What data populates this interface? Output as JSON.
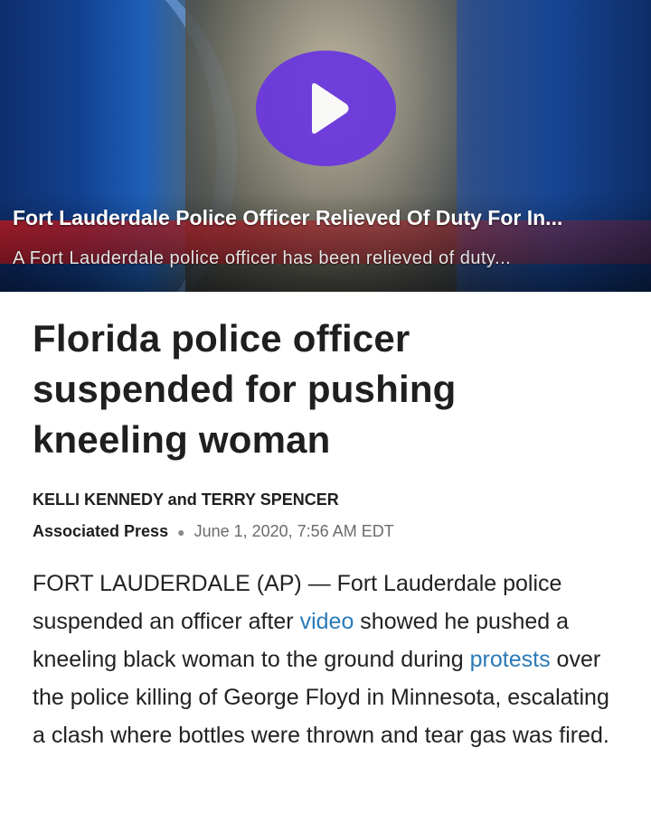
{
  "video": {
    "title": "Fort Lauderdale Police Officer Relieved Of Duty For In...",
    "subtitle": "A Fort Lauderdale police officer has been relieved of duty...",
    "play_color": "#6a36e0"
  },
  "article": {
    "headline_lines": [
      "Florida police officer",
      "suspended for pushing",
      "kneeling woman"
    ],
    "byline": "KELLI KENNEDY and TERRY SPENCER",
    "source": "Associated Press",
    "date": "June 1, 2020, 7:56 AM EDT",
    "body": {
      "part1": "FORT LAUDERDALE (AP) — Fort Lauderdale police suspended an officer after ",
      "link1": "video",
      "part2": " showed he pushed a kneeling black woman to the ground during ",
      "link2": "protests",
      "part3": " over the police killing of George Floyd in Minnesota, escalating a clash where bottles were thrown and tear gas was fired."
    },
    "link_color": "#2a7ab8"
  }
}
